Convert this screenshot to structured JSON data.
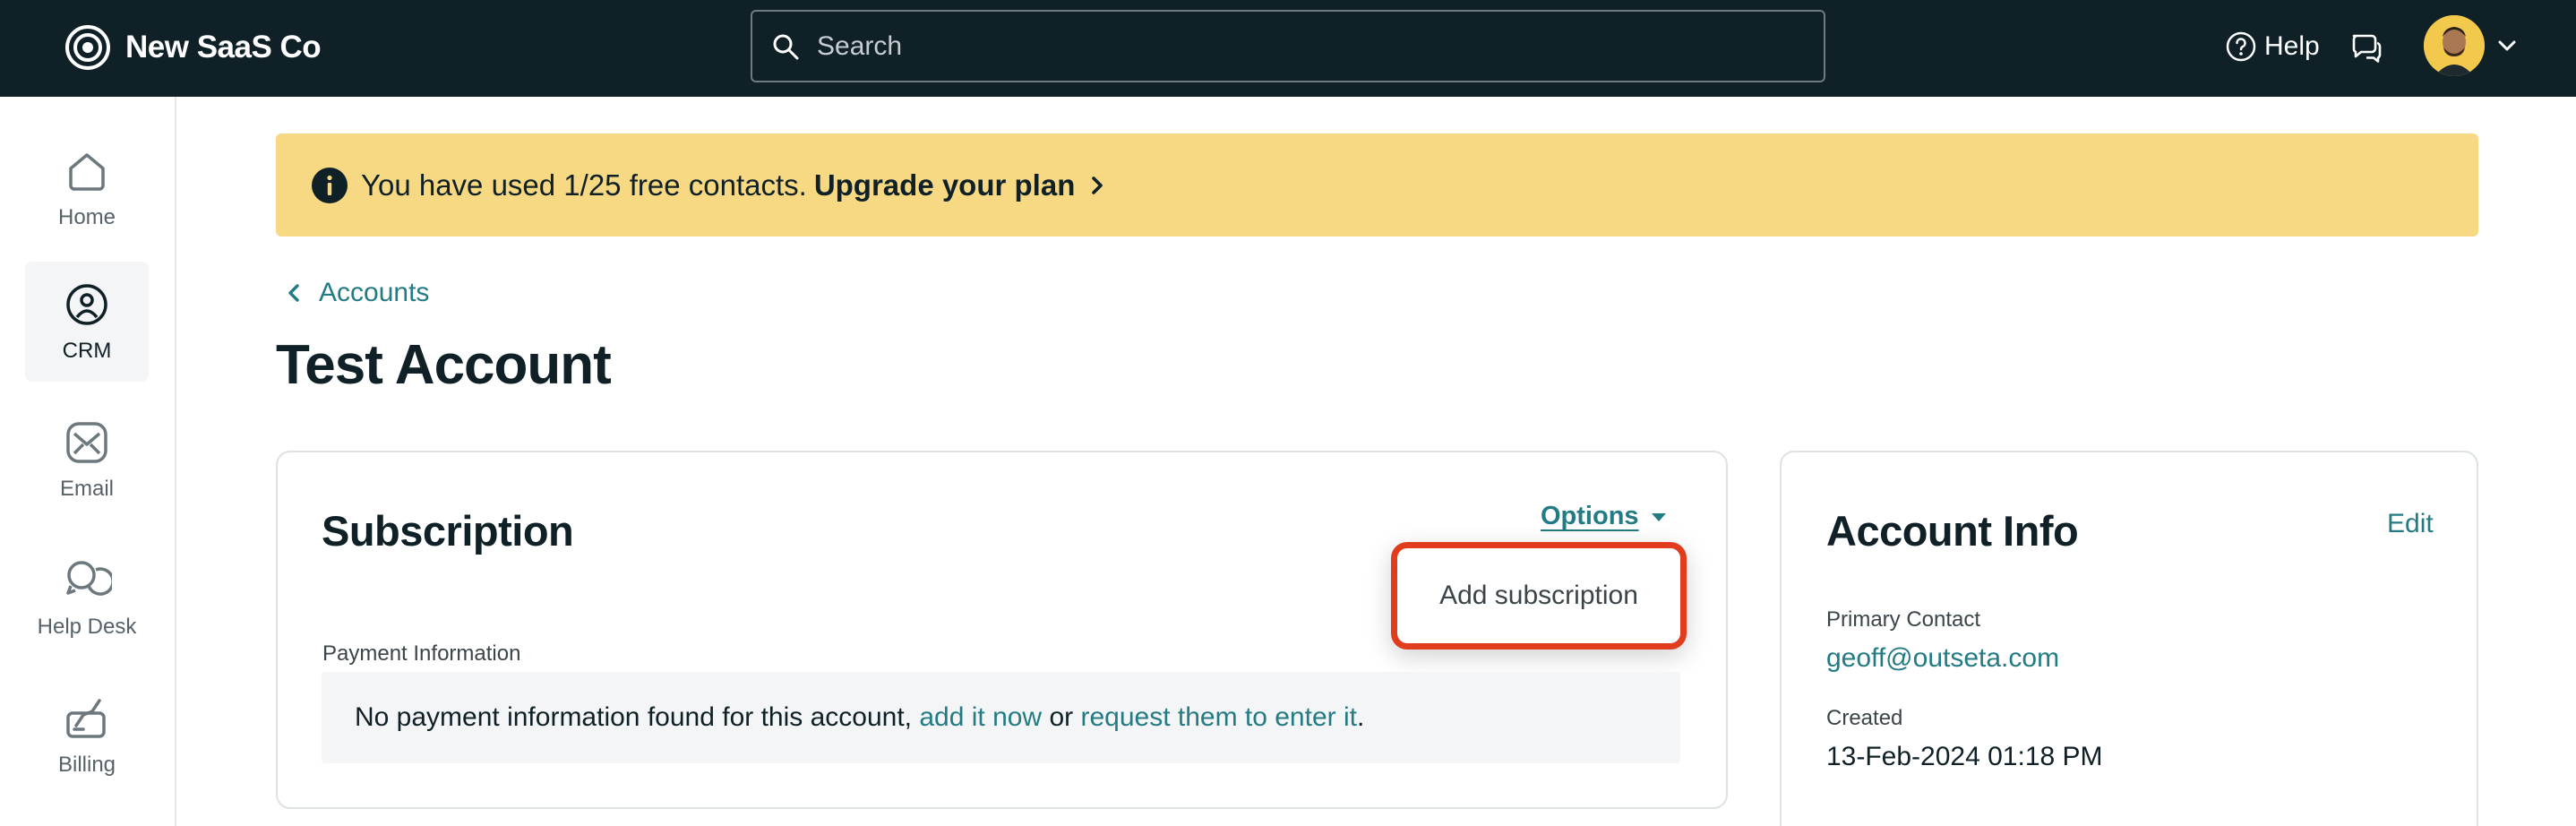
{
  "header": {
    "brand": "New SaaS Co",
    "search_placeholder": "Search",
    "help_label": "Help"
  },
  "sidebar": {
    "items": [
      {
        "label": "Home",
        "icon": "home-icon",
        "active": false
      },
      {
        "label": "CRM",
        "icon": "crm-icon",
        "active": true
      },
      {
        "label": "Email",
        "icon": "email-icon",
        "active": false
      },
      {
        "label": "Help Desk",
        "icon": "help-desk-icon",
        "active": false
      },
      {
        "label": "Billing",
        "icon": "billing-icon",
        "active": false
      }
    ]
  },
  "banner": {
    "text": "You have used 1/25 free contacts.",
    "link": "Upgrade your plan"
  },
  "breadcrumb": {
    "label": "Accounts"
  },
  "page": {
    "title": "Test Account"
  },
  "subscription": {
    "title": "Subscription",
    "options_label": "Options",
    "dropdown_items": [
      "Add subscription"
    ],
    "payment_label": "Payment Information",
    "payment_text_before": "No payment information found for this account, ",
    "payment_link_add": "add it now",
    "payment_text_mid": " or ",
    "payment_link_request": "request them to enter it",
    "payment_text_after": "."
  },
  "account_info": {
    "title": "Account Info",
    "edit_label": "Edit",
    "primary_contact_label": "Primary Contact",
    "primary_contact_value": "geoff@outseta.com",
    "created_label": "Created",
    "created_value": "13-Feb-2024 01:18 PM"
  },
  "colors": {
    "topbar": "#0f2027",
    "accent_link": "#237b84",
    "banner": "#f8d983",
    "highlight_border": "#e23c1f"
  }
}
